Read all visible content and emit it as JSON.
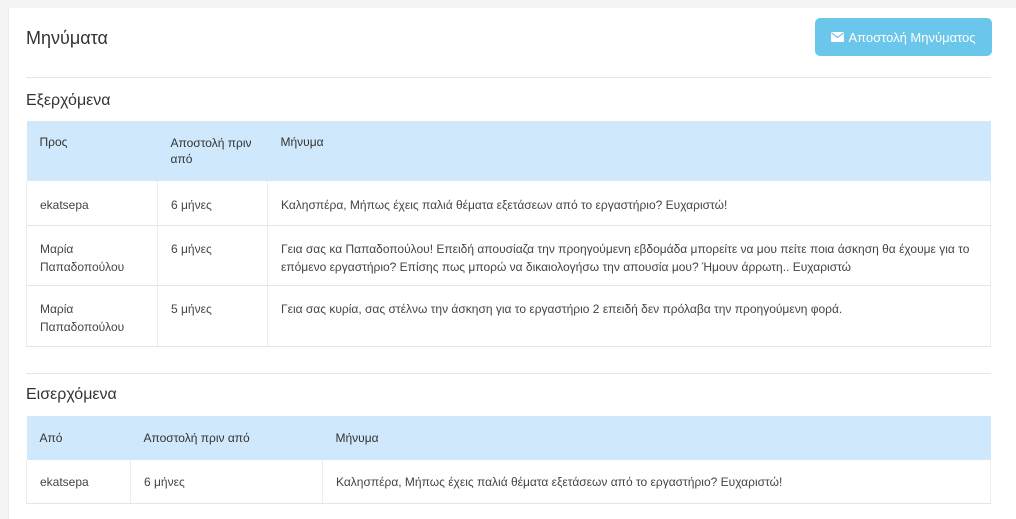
{
  "page": {
    "title": "Μηνύματα"
  },
  "actions": {
    "send_label": "Αποστολή Μηνύματος"
  },
  "outgoing": {
    "title": "Εξερχόμενα",
    "headers": {
      "to": "Προς",
      "sent": "Αποστολή πριν από",
      "message": "Μήνυμα"
    },
    "rows": [
      {
        "to": "ekatsepa",
        "sent": "6 μήνες",
        "message": "Καλησπέρα, Μήπως έχεις παλιά θέματα εξετάσεων από το εργαστήριο? Ευχαριστώ!"
      },
      {
        "to": "Μαρία Παπαδοπούλου",
        "sent": "6 μήνες",
        "message": "Γεια σας κα Παπαδοπούλου! Επειδή απουσίαζα την προηγούμενη εβδομάδα μπορείτε να μου πείτε ποια άσκηση θα έχουμε για το επόμενο εργαστήριο? Επίσης πως μπορώ να δικαιολογήσω την απουσία μου? Ήμουν άρρωτη.. Ευχαριστώ"
      },
      {
        "to": "Μαρία Παπαδοπούλου",
        "sent": "5 μήνες",
        "message": "Γεια σας κυρία, σας στέλνω την άσκηση για το εργαστήριο 2 επειδή δεν πρόλαβα την προηγούμενη φορά."
      }
    ]
  },
  "incoming": {
    "title": "Εισερχόμενα",
    "headers": {
      "from": "Από",
      "sent": "Αποστολή πριν από",
      "message": "Μήνυμα"
    },
    "rows": [
      {
        "from": "ekatsepa",
        "sent": "6 μήνες",
        "message": "Καλησπέρα, Μήπως έχεις παλιά θέματα εξετάσεων από το εργαστήριο? Ευχαριστώ!"
      }
    ]
  },
  "icons": {
    "send": "envelope-icon"
  },
  "colors": {
    "button": "#6ac6ea",
    "header_bg": "#cfe8fb"
  }
}
